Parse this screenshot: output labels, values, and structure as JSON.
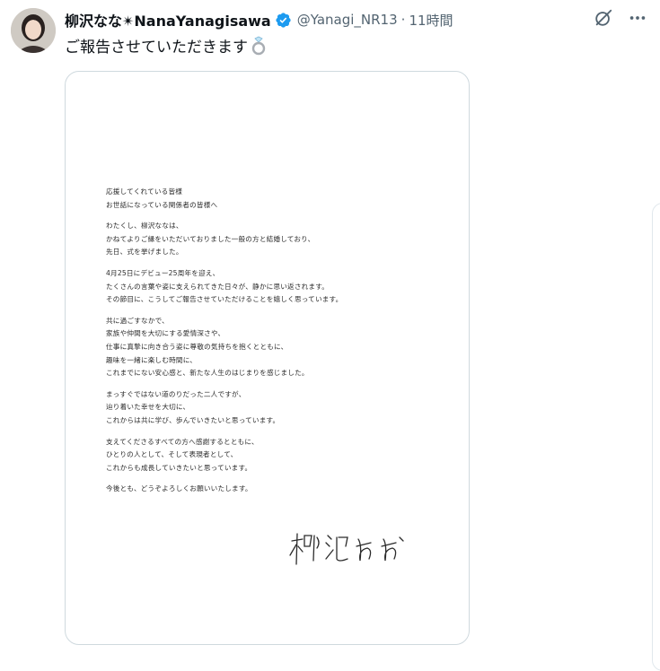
{
  "tweet": {
    "display_name": "柳沢なな✴NanaYanagisawa",
    "handle": "@Yanagi_NR13",
    "dot": "·",
    "time": "11時間",
    "text": "ご報告させていただきます"
  },
  "icons": {
    "avatar": "avatar-photo",
    "verified": "verified-badge-icon",
    "grok": "grok-icon",
    "more": "more-icon",
    "ring": "ring-emoji"
  },
  "letter": {
    "paragraphs": [
      [
        "応援してくれている皆様",
        "お世話になっている関係者の皆様へ"
      ],
      [
        "わたくし、柳沢ななは、",
        "かねてよりご縁をいただいておりました一般の方と結婚しており、",
        "先日、式を挙げました。"
      ],
      [
        "4月25日にデビュー25周年を迎え、",
        "たくさんの言葉や姿に支えられてきた日々が、静かに思い返されます。",
        "その節目に、こうしてご報告させていただけることを嬉しく思っています。"
      ],
      [
        "共に過ごすなかで、",
        "家族や仲間を大切にする愛情深さや、",
        "仕事に真摯に向き合う姿に尊敬の気持ちを抱くとともに、",
        "趣味を一緒に楽しむ時間に、",
        "これまでにない安心感と、新たな人生のはじまりを感じました。"
      ],
      [
        "まっすぐではない道のりだった二人ですが、",
        "辿り着いた幸せを大切に、",
        "これからは共に学び、歩んでいきたいと思っています。"
      ],
      [
        "支えてくださるすべての方へ感謝するとともに、",
        "ひとりの人として、そして表現者として、",
        "これからも成長していきたいと思っています。"
      ],
      [
        "今後とも、どうぞよろしくお願いいたします。"
      ]
    ]
  },
  "colors": {
    "verified": "#1d9bf0",
    "secondary_text": "#536471",
    "border": "#cfd9de"
  }
}
